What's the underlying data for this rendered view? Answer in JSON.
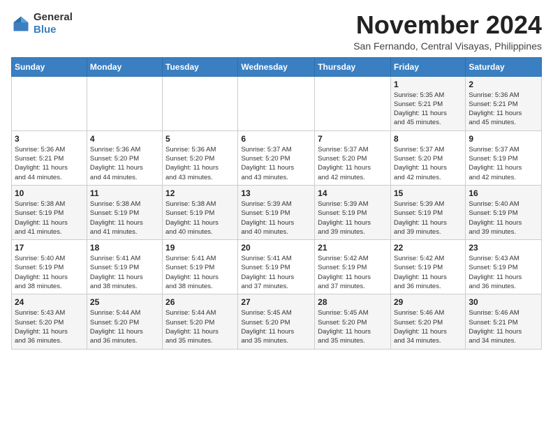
{
  "logo": {
    "general": "General",
    "blue": "Blue"
  },
  "title": "November 2024",
  "subtitle": "San Fernando, Central Visayas, Philippines",
  "weekdays": [
    "Sunday",
    "Monday",
    "Tuesday",
    "Wednesday",
    "Thursday",
    "Friday",
    "Saturday"
  ],
  "weeks": [
    [
      {
        "day": "",
        "info": ""
      },
      {
        "day": "",
        "info": ""
      },
      {
        "day": "",
        "info": ""
      },
      {
        "day": "",
        "info": ""
      },
      {
        "day": "",
        "info": ""
      },
      {
        "day": "1",
        "info": "Sunrise: 5:35 AM\nSunset: 5:21 PM\nDaylight: 11 hours\nand 45 minutes."
      },
      {
        "day": "2",
        "info": "Sunrise: 5:36 AM\nSunset: 5:21 PM\nDaylight: 11 hours\nand 45 minutes."
      }
    ],
    [
      {
        "day": "3",
        "info": "Sunrise: 5:36 AM\nSunset: 5:21 PM\nDaylight: 11 hours\nand 44 minutes."
      },
      {
        "day": "4",
        "info": "Sunrise: 5:36 AM\nSunset: 5:20 PM\nDaylight: 11 hours\nand 44 minutes."
      },
      {
        "day": "5",
        "info": "Sunrise: 5:36 AM\nSunset: 5:20 PM\nDaylight: 11 hours\nand 43 minutes."
      },
      {
        "day": "6",
        "info": "Sunrise: 5:37 AM\nSunset: 5:20 PM\nDaylight: 11 hours\nand 43 minutes."
      },
      {
        "day": "7",
        "info": "Sunrise: 5:37 AM\nSunset: 5:20 PM\nDaylight: 11 hours\nand 42 minutes."
      },
      {
        "day": "8",
        "info": "Sunrise: 5:37 AM\nSunset: 5:20 PM\nDaylight: 11 hours\nand 42 minutes."
      },
      {
        "day": "9",
        "info": "Sunrise: 5:37 AM\nSunset: 5:19 PM\nDaylight: 11 hours\nand 42 minutes."
      }
    ],
    [
      {
        "day": "10",
        "info": "Sunrise: 5:38 AM\nSunset: 5:19 PM\nDaylight: 11 hours\nand 41 minutes."
      },
      {
        "day": "11",
        "info": "Sunrise: 5:38 AM\nSunset: 5:19 PM\nDaylight: 11 hours\nand 41 minutes."
      },
      {
        "day": "12",
        "info": "Sunrise: 5:38 AM\nSunset: 5:19 PM\nDaylight: 11 hours\nand 40 minutes."
      },
      {
        "day": "13",
        "info": "Sunrise: 5:39 AM\nSunset: 5:19 PM\nDaylight: 11 hours\nand 40 minutes."
      },
      {
        "day": "14",
        "info": "Sunrise: 5:39 AM\nSunset: 5:19 PM\nDaylight: 11 hours\nand 39 minutes."
      },
      {
        "day": "15",
        "info": "Sunrise: 5:39 AM\nSunset: 5:19 PM\nDaylight: 11 hours\nand 39 minutes."
      },
      {
        "day": "16",
        "info": "Sunrise: 5:40 AM\nSunset: 5:19 PM\nDaylight: 11 hours\nand 39 minutes."
      }
    ],
    [
      {
        "day": "17",
        "info": "Sunrise: 5:40 AM\nSunset: 5:19 PM\nDaylight: 11 hours\nand 38 minutes."
      },
      {
        "day": "18",
        "info": "Sunrise: 5:41 AM\nSunset: 5:19 PM\nDaylight: 11 hours\nand 38 minutes."
      },
      {
        "day": "19",
        "info": "Sunrise: 5:41 AM\nSunset: 5:19 PM\nDaylight: 11 hours\nand 38 minutes."
      },
      {
        "day": "20",
        "info": "Sunrise: 5:41 AM\nSunset: 5:19 PM\nDaylight: 11 hours\nand 37 minutes."
      },
      {
        "day": "21",
        "info": "Sunrise: 5:42 AM\nSunset: 5:19 PM\nDaylight: 11 hours\nand 37 minutes."
      },
      {
        "day": "22",
        "info": "Sunrise: 5:42 AM\nSunset: 5:19 PM\nDaylight: 11 hours\nand 36 minutes."
      },
      {
        "day": "23",
        "info": "Sunrise: 5:43 AM\nSunset: 5:19 PM\nDaylight: 11 hours\nand 36 minutes."
      }
    ],
    [
      {
        "day": "24",
        "info": "Sunrise: 5:43 AM\nSunset: 5:20 PM\nDaylight: 11 hours\nand 36 minutes."
      },
      {
        "day": "25",
        "info": "Sunrise: 5:44 AM\nSunset: 5:20 PM\nDaylight: 11 hours\nand 36 minutes."
      },
      {
        "day": "26",
        "info": "Sunrise: 5:44 AM\nSunset: 5:20 PM\nDaylight: 11 hours\nand 35 minutes."
      },
      {
        "day": "27",
        "info": "Sunrise: 5:45 AM\nSunset: 5:20 PM\nDaylight: 11 hours\nand 35 minutes."
      },
      {
        "day": "28",
        "info": "Sunrise: 5:45 AM\nSunset: 5:20 PM\nDaylight: 11 hours\nand 35 minutes."
      },
      {
        "day": "29",
        "info": "Sunrise: 5:46 AM\nSunset: 5:20 PM\nDaylight: 11 hours\nand 34 minutes."
      },
      {
        "day": "30",
        "info": "Sunrise: 5:46 AM\nSunset: 5:21 PM\nDaylight: 11 hours\nand 34 minutes."
      }
    ]
  ]
}
